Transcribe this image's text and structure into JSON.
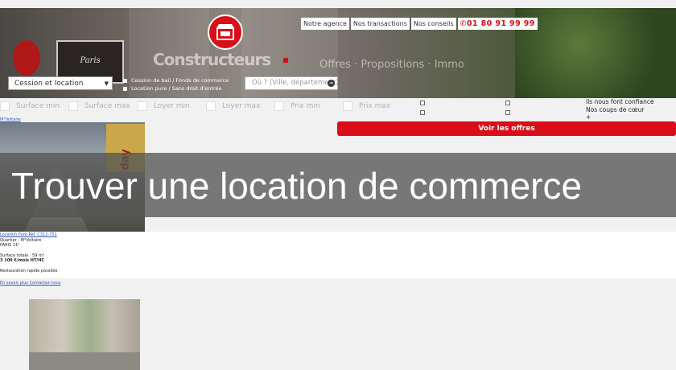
{
  "top_nav": {
    "item1": "Notre agence",
    "item2": "Nos transactions",
    "item3": "Nos conseils",
    "phone": "01 80 91 99 99"
  },
  "hero": {
    "brand_ghost": "Constructeurs",
    "nav_ghost": "Offres · Propositions · Immo",
    "shop_sign": "Paris"
  },
  "search": {
    "type_select": "Cession et location",
    "option1": "Cession de bail / Fonds de commerce",
    "option2": "Location pure / Sans droit d'entrée",
    "where_placeholder": "Où ? (Ville, département)"
  },
  "filters": {
    "surface_min": "Surface min",
    "surface_max": "Surface max",
    "loyer_min": "Loyer min",
    "loyer_max": "Loyer max",
    "prix_min": "Prix min",
    "prix_max": "Prix max"
  },
  "side": {
    "item1": "Ils nous font confiance",
    "item2": "Nos coups de cœur",
    "item3": "+"
  },
  "cta": {
    "label": "Voir les offres"
  },
  "listing": {
    "top_link": "M°Voltaire",
    "shop_text": "day",
    "ref": "Location Pure Réf. C312-751",
    "quarter_label": "Quartier : M°Voltaire",
    "city": "PARIS 11ᵉ",
    "surface": "Surface totale : 59 m²",
    "rent": "3 100 €/mois HT/HC",
    "activity": "Restauration rapide possible",
    "more": "En savoir plus Contactez-nous"
  },
  "banner": {
    "title": "Trouver une location de commerce"
  },
  "colors": {
    "accent": "#d90e18",
    "banner_bg": "#555555",
    "page_bg": "#f1f1f1"
  }
}
